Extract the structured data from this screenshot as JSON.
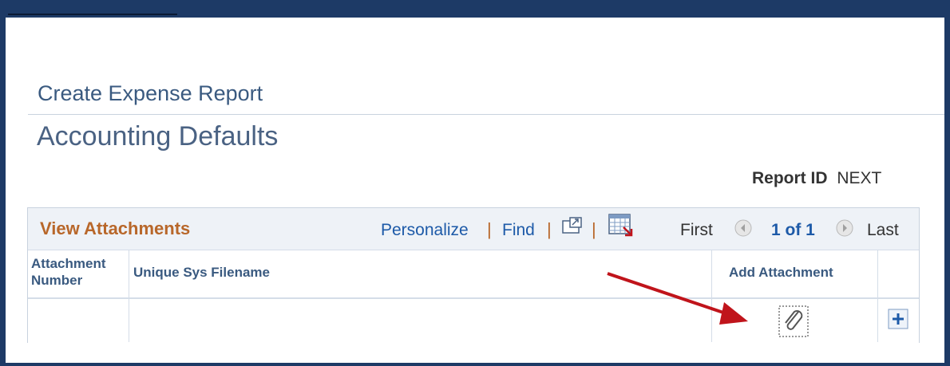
{
  "header": {
    "breadcrumb": "Create Expense Report",
    "page_title": "Accounting Defaults",
    "report_id_label": "Report ID",
    "report_id_value": "NEXT"
  },
  "grid": {
    "title": "View Attachments",
    "personalize": "Personalize",
    "find": "Find",
    "separator": "|",
    "first": "First",
    "page_info": "1 of 1",
    "last": "Last",
    "columns": {
      "attachment_number": "Attachment Number",
      "unique_sys_filename": "Unique Sys Filename",
      "add_attachment": "Add Attachment"
    }
  },
  "icons": {
    "view_all": "popout-icon",
    "download": "spreadsheet-download-icon",
    "prev": "prev-arrow-icon",
    "next": "next-arrow-icon",
    "attach": "paperclip-icon",
    "add_row": "plus-icon",
    "annotation": "red-arrow-annotation"
  },
  "colors": {
    "frame": "#1d3a66",
    "link": "#1d5aa8",
    "grid_title": "#b8672a",
    "annotation_arrow": "#c0141b"
  }
}
